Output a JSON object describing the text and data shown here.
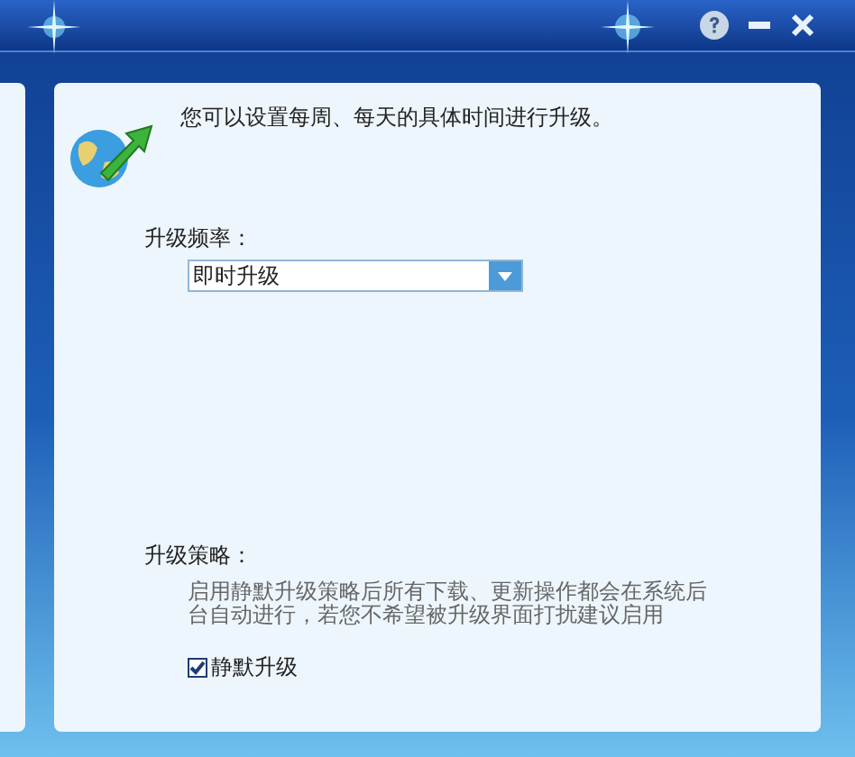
{
  "intro": "您可以设置每周、每天的具体时间进行升级。",
  "frequency": {
    "label": "升级频率：",
    "value": "即时升级"
  },
  "strategy": {
    "label": "升级策略：",
    "description": "启用静默升级策略后所有下载、更新操作都会在系统后台自动进行，若您不希望被升级界面打扰建议启用",
    "checkbox": {
      "label": "静默升级",
      "checked": true
    }
  }
}
